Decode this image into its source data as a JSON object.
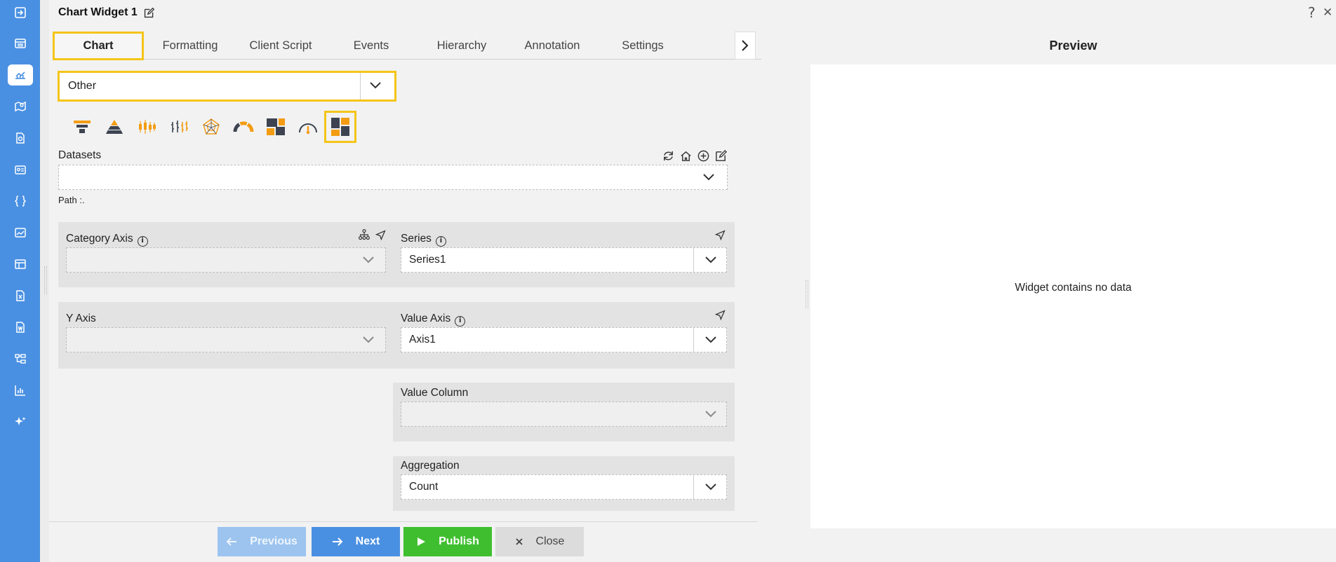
{
  "window": {
    "title": "Chart Widget 1",
    "help": "?",
    "close": "✕"
  },
  "rail": {
    "icons": [
      "sign-in-icon",
      "list-icon",
      "chart-icon",
      "map-icon",
      "document-icon",
      "contact-card-icon",
      "braces-icon",
      "image-chart-icon",
      "grid-table-icon",
      "excel-icon",
      "word-icon",
      "hierarchy-icon",
      "bar-chart-icon",
      "sparkle-icon"
    ],
    "active_index": 2
  },
  "tabs": [
    {
      "label": "Chart",
      "active": true
    },
    {
      "label": "Formatting"
    },
    {
      "label": "Client Script"
    },
    {
      "label": "Events"
    },
    {
      "label": "Hierarchy"
    },
    {
      "label": "Annotation"
    },
    {
      "label": "Settings"
    }
  ],
  "chart_type": {
    "value": "Other"
  },
  "chart_icons": [
    "funnel-icon",
    "pyramid-icon",
    "candlestick-icon",
    "ohlc-icon",
    "radar-icon",
    "semi-gauge-icon",
    "treemap-icon",
    "gauge-icon",
    "heatmap-tile-icon"
  ],
  "datasets": {
    "label": "Datasets",
    "value": "",
    "path": "Path :."
  },
  "category_axis": {
    "label": "Category Axis",
    "value": ""
  },
  "series": {
    "label": "Series",
    "value": "Series1"
  },
  "y_axis": {
    "label": "Y Axis",
    "value": ""
  },
  "value_axis": {
    "label": "Value Axis",
    "value": "Axis1"
  },
  "value_column": {
    "label": "Value Column",
    "value": ""
  },
  "aggregation": {
    "label": "Aggregation",
    "value": "Count"
  },
  "buttons": {
    "previous": "Previous",
    "next": "Next",
    "publish": "Publish",
    "close": "Close"
  },
  "preview": {
    "title": "Preview",
    "message": "Widget contains no data"
  },
  "colors": {
    "accent": "#4a90e2",
    "highlight": "#f5c518",
    "publish": "#3fbf2f",
    "orange": "#f39c12",
    "dark": "#3d4350"
  }
}
